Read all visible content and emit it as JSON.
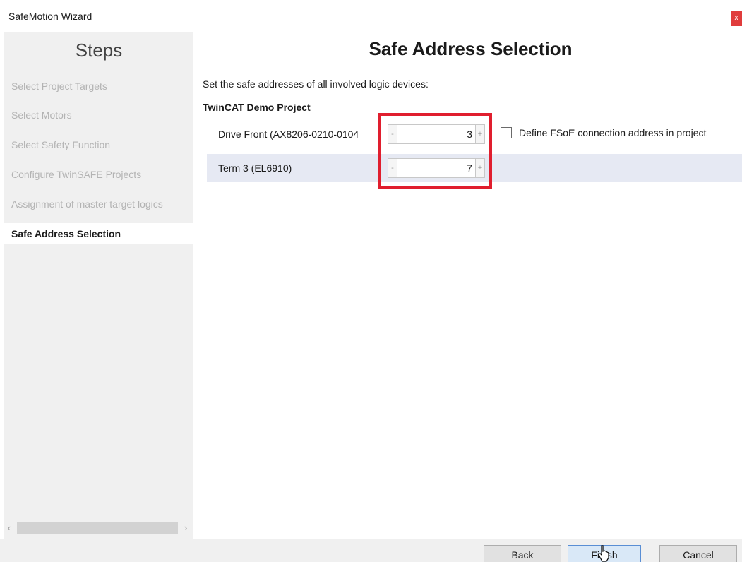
{
  "window": {
    "title": "SafeMotion Wizard",
    "close_label": "x"
  },
  "sidebar": {
    "heading": "Steps",
    "items": [
      {
        "label": "Select Project Targets"
      },
      {
        "label": "Select Motors"
      },
      {
        "label": "Select Safety Function"
      },
      {
        "label": "Configure TwinSAFE Projects"
      },
      {
        "label": "Assignment of master target logics"
      },
      {
        "label": "Safe Address Selection"
      }
    ],
    "active_item": "Safe Address Selection",
    "scroll_left": "‹",
    "scroll_right": "›"
  },
  "main": {
    "title": "Safe Address Selection",
    "instructions": "Set the safe addresses of all involved logic devices:",
    "project_name": "TwinCAT Demo Project",
    "devices": [
      {
        "name": "Drive Front (AX8206-0210-0104",
        "address": "3",
        "decrement": "-",
        "increment": "+"
      },
      {
        "name": "Term 3 (EL6910)",
        "address": "7",
        "decrement": "-",
        "increment": "+"
      }
    ],
    "fsoe_checkbox_label": "Define FSoE connection address in project",
    "fsoe_checkbox_checked": false
  },
  "footer": {
    "back_label": "Back",
    "finish_label": "Finish",
    "cancel_label": "Cancel"
  },
  "colors": {
    "highlight": "#e01e2e",
    "sidebar_bg": "#f0f0f0",
    "row_alt": "#e6e9f3"
  }
}
